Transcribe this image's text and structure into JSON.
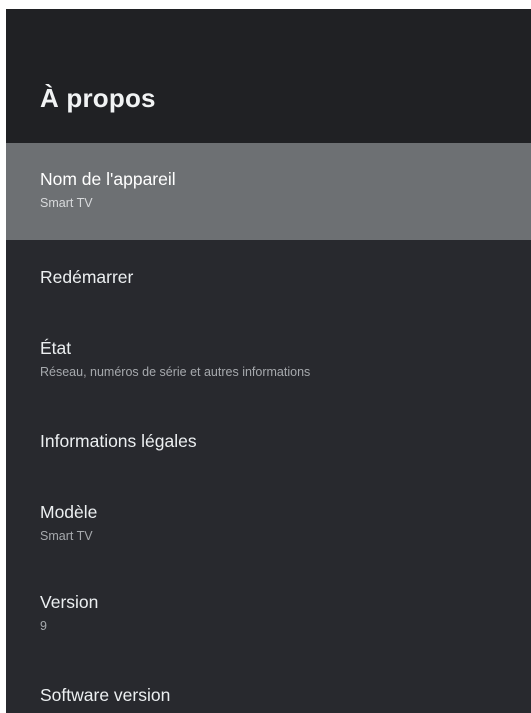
{
  "header": {
    "title": "À propos"
  },
  "settings": {
    "items": [
      {
        "title": "Nom de l'appareil",
        "summary": "Smart TV"
      },
      {
        "title": "Redémarrer",
        "summary": ""
      },
      {
        "title": "État",
        "summary": "Réseau, numéros de série et autres informations"
      },
      {
        "title": "Informations légales",
        "summary": ""
      },
      {
        "title": "Modèle",
        "summary": "Smart TV"
      },
      {
        "title": "Version",
        "summary": "9"
      },
      {
        "title": "Software version",
        "summary": ""
      }
    ],
    "focused_index": 0
  },
  "colors": {
    "header_bg": "#202124",
    "list_bg": "#28292e",
    "focus_bg": "#6d7073",
    "title_text": "#eceff1",
    "summary_text": "#a6a9ad"
  }
}
